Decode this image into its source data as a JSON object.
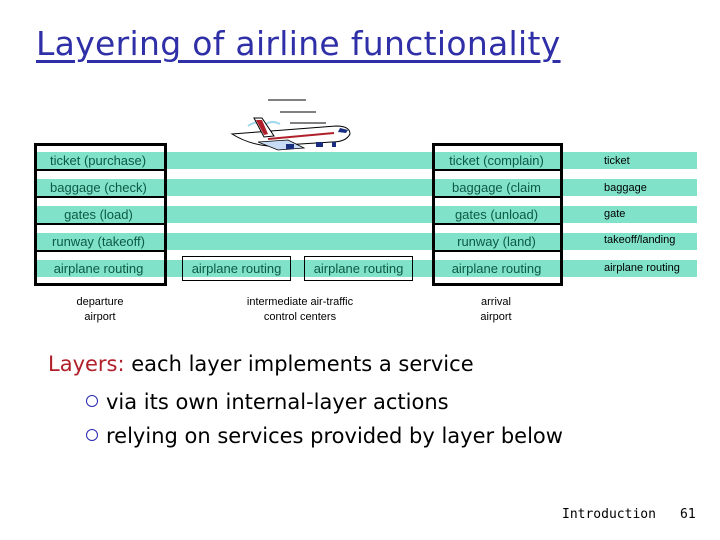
{
  "slide": {
    "title": "Layering of airline functionality",
    "page_number": "61",
    "section": "Introduction"
  },
  "colors": {
    "layer_bar": "#80e2c9",
    "title": "#2f2fa8",
    "accent": "#b0202a",
    "cell_text": "#0c5a44"
  },
  "departure": {
    "layers": [
      "ticket (purchase)",
      "baggage (check)",
      "gates (load)",
      "runway (takeoff)",
      "airplane routing"
    ],
    "caption_line1": "departure",
    "caption_line2": "airport"
  },
  "intermediate": {
    "boxes": [
      "airplane routing",
      "airplane routing"
    ],
    "caption_line1": "intermediate air-traffic",
    "caption_line2": "control centers"
  },
  "arrival": {
    "layers": [
      "ticket (complain)",
      "baggage (claim",
      "gates (unload)",
      "runway (land)",
      "airplane routing"
    ],
    "caption_line1": "arrival",
    "caption_line2": "airport"
  },
  "layer_names": [
    "ticket",
    "baggage",
    "gate",
    "takeoff/landing",
    "airplane routing"
  ],
  "explanation": {
    "lead_keyword": "Layers:",
    "lead_text": " each layer implements a service",
    "bullets": [
      "via its own internal-layer actions",
      "relying on services provided by layer below"
    ]
  },
  "icons": {
    "illustration": "airplane-icon",
    "bullet": "circle-bullet-icon"
  }
}
